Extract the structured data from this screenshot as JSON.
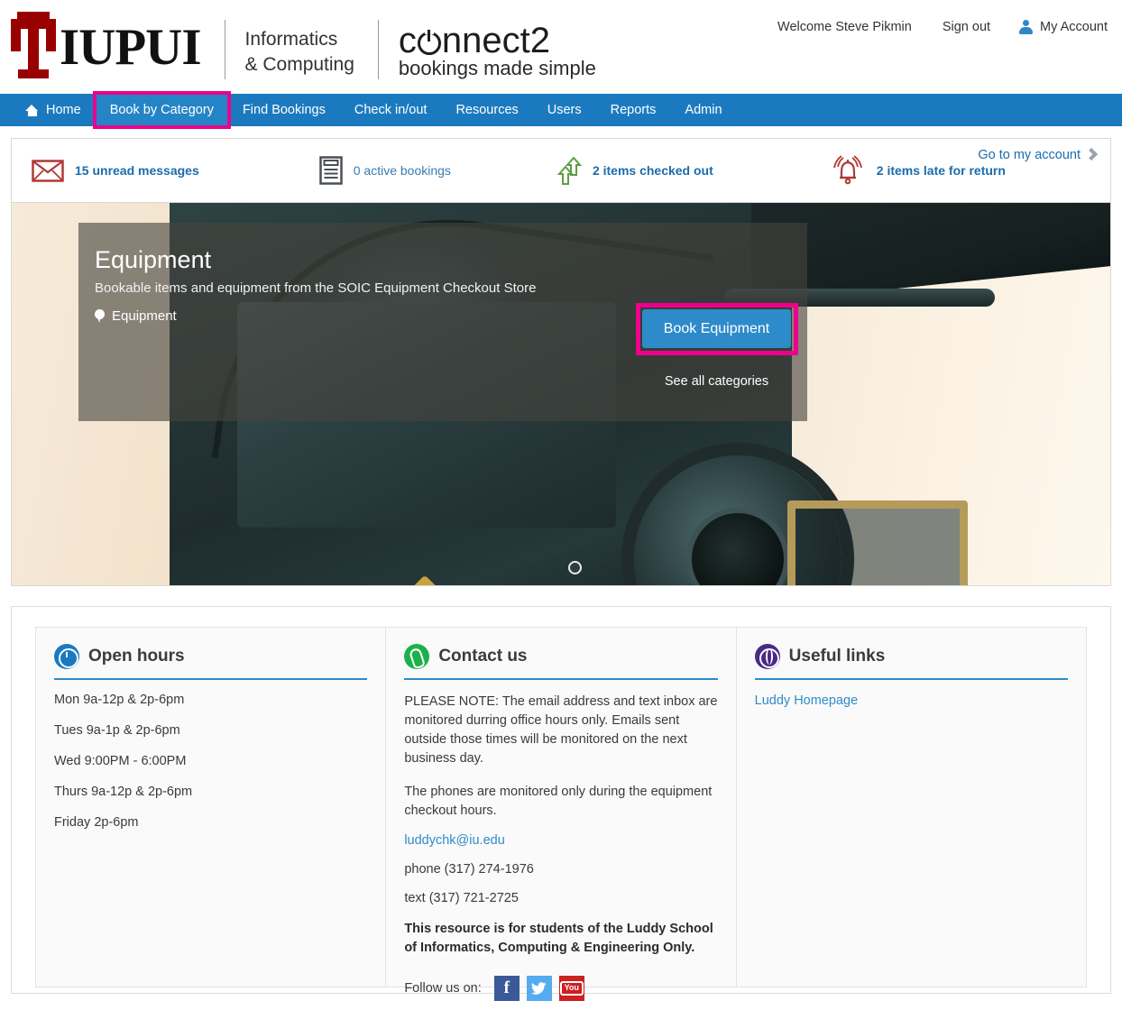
{
  "header": {
    "university": "IUPUI",
    "department_line1": "Informatics",
    "department_line2": "& Computing",
    "product_name_pre": "c",
    "product_name_post": "nnect2",
    "product_tagline": "bookings made simple",
    "welcome": "Welcome Steve Pikmin",
    "sign_out": "Sign out",
    "my_account": "My Account"
  },
  "nav": {
    "items": [
      {
        "label": "Home",
        "icon": "home-icon",
        "active": false,
        "highlighted": false
      },
      {
        "label": "Book by Category",
        "active": true,
        "highlighted": true
      },
      {
        "label": "Find Bookings",
        "active": false,
        "highlighted": false
      },
      {
        "label": "Check in/out",
        "active": false,
        "highlighted": false
      },
      {
        "label": "Resources",
        "active": false,
        "highlighted": false
      },
      {
        "label": "Users",
        "active": false,
        "highlighted": false
      },
      {
        "label": "Reports",
        "active": false,
        "highlighted": false
      },
      {
        "label": "Admin",
        "active": false,
        "highlighted": false
      }
    ]
  },
  "status_bar": {
    "unread_messages": "15 unread messages",
    "active_bookings": "0 active bookings",
    "items_checked_out": "2 items checked out",
    "items_late": "2 items late for return",
    "go_to_account": "Go to my account"
  },
  "hero": {
    "title": "Equipment",
    "subtitle": "Bookable items and equipment from the SOIC Equipment Checkout Store",
    "location": "Equipment",
    "primary_button": "Book Equipment",
    "secondary_link": "See all categories",
    "carousel_dots": 1
  },
  "open_hours": {
    "title": "Open hours",
    "icon": "clock-icon",
    "lines": [
      "Mon 9a-12p & 2p-6pm",
      "Tues 9a-1p & 2p-6pm",
      "Wed 9:00PM - 6:00PM",
      "Thurs 9a-12p & 2p-6pm",
      "Friday  2p-6pm"
    ]
  },
  "contact_us": {
    "title": "Contact us",
    "icon": "phone-icon",
    "note": "PLEASE NOTE: The email address and text inbox are monitored durring office hours only. Emails sent outside those times will be monitored on the next business day.",
    "phones_note": "The phones are monitored only during the equipment checkout hours.",
    "email": "luddychk@iu.edu",
    "phone": "phone (317) 274-1976",
    "text": "text (317) 721-2725",
    "restriction": "This resource is for students of the Luddy School of Informatics, Computing & Engineering Only.",
    "follow_label": "Follow us on:",
    "socials": [
      {
        "name": "facebook-icon",
        "glyph": "f"
      },
      {
        "name": "twitter-icon",
        "glyph": "ᴗ"
      },
      {
        "name": "youtube-icon",
        "glyph": "You"
      }
    ]
  },
  "useful_links": {
    "title": "Useful links",
    "icon": "globe-icon",
    "links": [
      "Luddy Homepage"
    ]
  },
  "colors": {
    "nav_blue": "#1b7abf",
    "accent_blue": "#2e8bc9",
    "highlight_magenta": "#ec008c",
    "iu_crimson": "#990000",
    "link_blue": "#2e8bc9",
    "clock_icon": "#1b7abf",
    "phone_icon": "#1cb14c",
    "globe_icon": "#4b2a85"
  }
}
